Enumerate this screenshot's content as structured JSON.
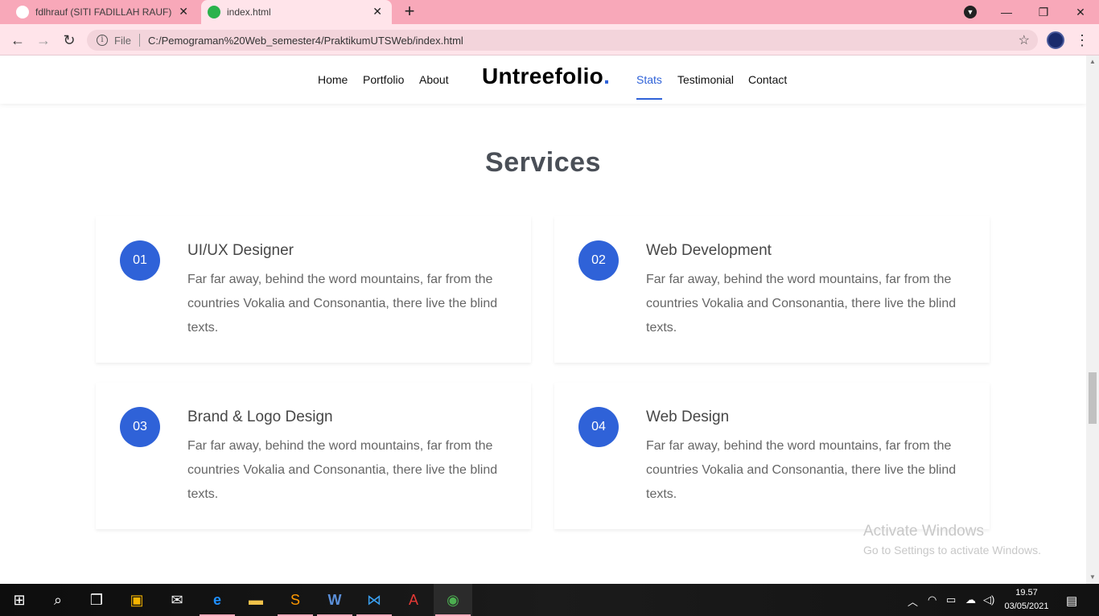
{
  "browser": {
    "tabs": [
      {
        "title": "fdlhrauf (SITI FADILLAH RAUF)",
        "active": false
      },
      {
        "title": "index.html",
        "active": true
      }
    ],
    "address": {
      "scheme_label": "File",
      "url": "C:/Pemograman%20Web_semester4/PraktikumUTSWeb/index.html"
    }
  },
  "site": {
    "nav_left": [
      "Home",
      "Portfolio",
      "About"
    ],
    "brand": "Untreefolio",
    "brand_dot": ".",
    "nav_right": [
      "Stats",
      "Testimonial",
      "Contact"
    ],
    "active_nav": "Stats"
  },
  "services": {
    "title": "Services",
    "items": [
      {
        "num": "01",
        "title": "UI/UX Designer",
        "desc": "Far far away, behind the word mountains, far from the countries Vokalia and Consonantia, there live the blind texts."
      },
      {
        "num": "02",
        "title": "Web Development",
        "desc": "Far far away, behind the word mountains, far from the countries Vokalia and Consonantia, there live the blind texts."
      },
      {
        "num": "03",
        "title": "Brand & Logo Design",
        "desc": "Far far away, behind the word mountains, far from the countries Vokalia and Consonantia, there live the blind texts."
      },
      {
        "num": "04",
        "title": "Web Design",
        "desc": "Far far away, behind the word mountains, far from the countries Vokalia and Consonantia, there live the blind texts."
      }
    ]
  },
  "watermark": {
    "line1": "Activate Windows",
    "line2": "Go to Settings to activate Windows."
  },
  "taskbar": {
    "time": "19.57",
    "date": "03/05/2021"
  },
  "colors": {
    "accent": "#2f62d8",
    "tab_strip": "#f8a8b9"
  }
}
